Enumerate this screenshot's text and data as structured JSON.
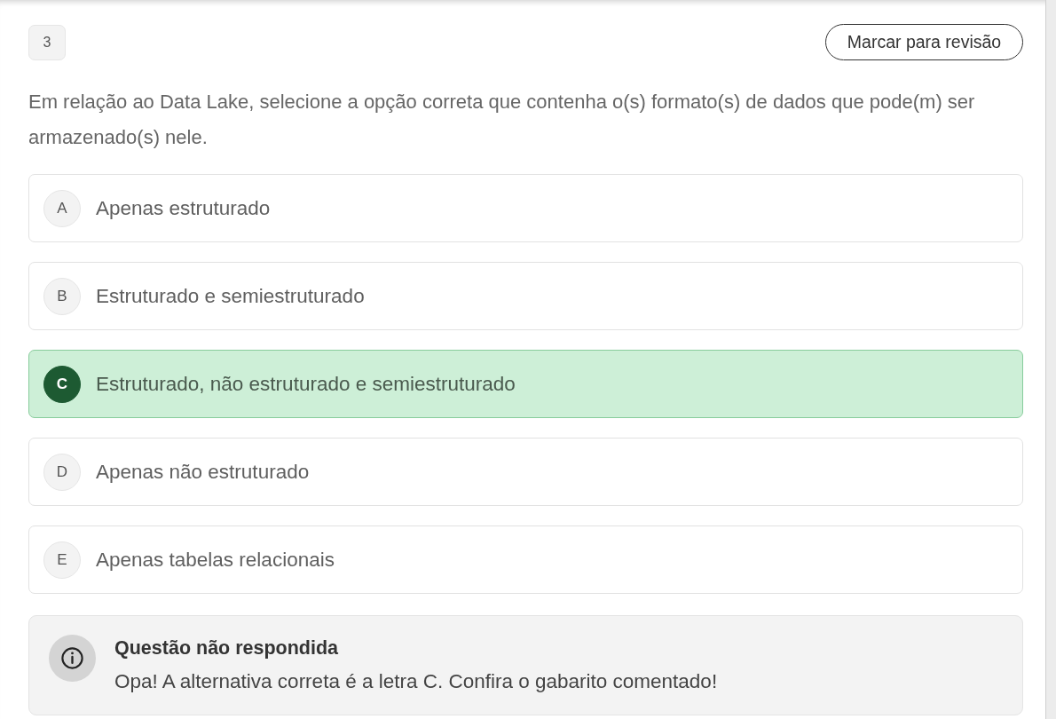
{
  "question": {
    "number": "3",
    "review_button": "Marcar para revisão",
    "text": "Em relação ao Data Lake, selecione a opção correta que contenha o(s) formato(s) de dados que pode(m) ser armazenado(s) nele."
  },
  "options": [
    {
      "letter": "A",
      "text": "Apenas estruturado",
      "correct": false
    },
    {
      "letter": "B",
      "text": "Estruturado e semiestruturado",
      "correct": false
    },
    {
      "letter": "C",
      "text": "Estruturado, não estruturado e semiestruturado",
      "correct": true
    },
    {
      "letter": "D",
      "text": "Apenas não estruturado",
      "correct": false
    },
    {
      "letter": "E",
      "text": "Apenas tabelas relacionais",
      "correct": false
    }
  ],
  "feedback": {
    "title": "Questão não respondida",
    "message": "Opa! A alternativa correta é a letra C. Confira o gabarito comentado!"
  }
}
